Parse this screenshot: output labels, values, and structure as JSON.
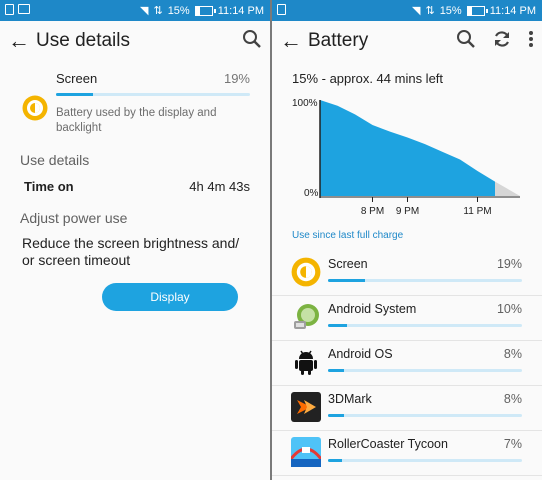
{
  "status": {
    "battery_percent": "15%",
    "time": "11:14 PM"
  },
  "left": {
    "title": "Use details",
    "entry": {
      "name": "Screen",
      "percent": "19%",
      "bar_fraction": 0.19,
      "description": "Battery used by the display and backlight"
    },
    "use_details_header": "Use details",
    "time_on_label": "Time on",
    "time_on_value": "4h 4m 43s",
    "adjust_header": "Adjust power use",
    "reduce_text": "Reduce the screen brightness and/ or screen timeout",
    "display_button": "Display"
  },
  "right": {
    "title": "Battery",
    "summary": "15% - approx. 44 mins left",
    "use_since": "Use since last full charge",
    "apps": [
      {
        "name": "Screen",
        "percent": "19%",
        "fraction": 0.19,
        "icon": "screen-brightness-icon"
      },
      {
        "name": "Android System",
        "percent": "10%",
        "fraction": 0.1,
        "icon": "android-system-icon"
      },
      {
        "name": "Android OS",
        "percent": "8%",
        "fraction": 0.08,
        "icon": "android-os-icon"
      },
      {
        "name": "3DMark",
        "percent": "8%",
        "fraction": 0.08,
        "icon": "3dmark-icon"
      },
      {
        "name": "RollerCoaster Tycoon",
        "percent": "7%",
        "fraction": 0.07,
        "icon": "rollercoaster-tycoon-icon"
      }
    ]
  },
  "chart_data": {
    "type": "area",
    "title": "",
    "xlabel": "",
    "ylabel": "",
    "y_ticks": [
      "100%",
      "0%"
    ],
    "x_ticks": [
      "8 PM",
      "9 PM",
      "11 PM"
    ],
    "ylim": [
      0,
      100
    ],
    "series": [
      {
        "x": [
          "7:00 PM",
          "7:10 PM",
          "7:30 PM",
          "8:00 PM",
          "8:30 PM",
          "9:00 PM",
          "9:30 PM",
          "10:00 PM",
          "10:30 PM",
          "11:00 PM",
          "11:14 PM"
        ],
        "values": [
          100,
          94,
          85,
          74,
          67,
          61,
          54,
          46,
          38,
          26,
          15
        ]
      }
    ],
    "projection": {
      "from": 15,
      "to": 0
    },
    "colors": {
      "fill": "#1ea3e0",
      "projection": "#d6d6d6"
    }
  }
}
